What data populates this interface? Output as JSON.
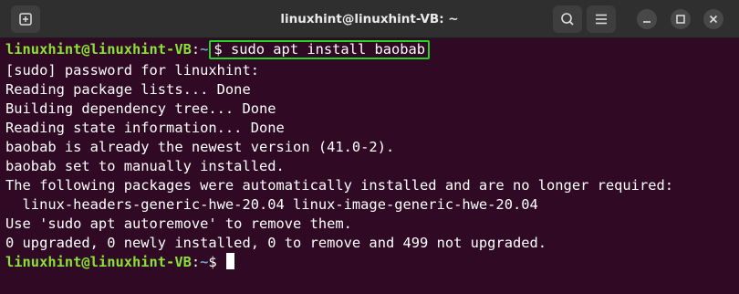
{
  "window": {
    "title": "linuxhint@linuxhint-VB: ~"
  },
  "icons": {
    "new_tab": "new-tab-icon",
    "search": "search-icon",
    "menu": "hamburger-menu-icon",
    "minimize": "minimize-icon",
    "maximize": "maximize-icon",
    "close": "close-icon"
  },
  "colors": {
    "terminal_bg": "#300a24",
    "prompt_user": "#8ae234",
    "prompt_path": "#729fcf",
    "highlight_box": "#22d622"
  },
  "terminal": {
    "prompt1": {
      "user": "linuxhint@linuxhint-VB",
      "colon": ":",
      "path": "~",
      "command": "$ sudo apt install baobab"
    },
    "output": [
      "[sudo] password for linuxhint:",
      "Reading package lists... Done",
      "Building dependency tree... Done",
      "Reading state information... Done",
      "baobab is already the newest version (41.0-2).",
      "baobab set to manually installed.",
      "The following packages were automatically installed and are no longer required:",
      "  linux-headers-generic-hwe-20.04 linux-image-generic-hwe-20.04",
      "Use 'sudo apt autoremove' to remove them.",
      "0 upgraded, 0 newly installed, 0 to remove and 499 not upgraded."
    ],
    "prompt2": {
      "user": "linuxhint@linuxhint-VB",
      "colon": ":",
      "path": "~",
      "dollar": "$ "
    }
  }
}
